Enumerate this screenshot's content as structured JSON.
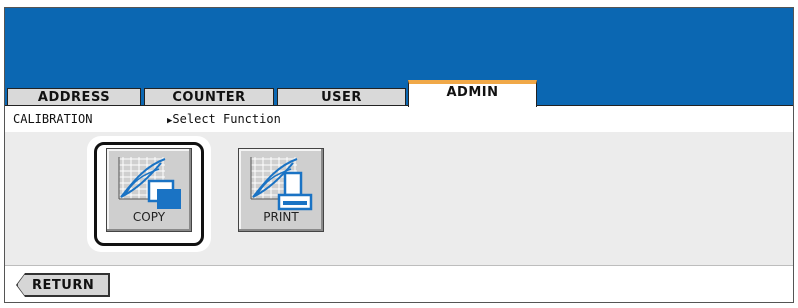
{
  "tabs": [
    {
      "label": "ADDRESS"
    },
    {
      "label": "COUNTER"
    },
    {
      "label": "USER"
    },
    {
      "label": "ADMIN",
      "active": true
    }
  ],
  "breadcrumb": {
    "section": "CALIBRATION",
    "arrow_icon": "triangle-right-icon",
    "instruction": "Select Function"
  },
  "functions": [
    {
      "label": "COPY",
      "icon": "copy-calibration-icon",
      "selected": true
    },
    {
      "label": "PRINT",
      "icon": "print-calibration-icon",
      "selected": false
    }
  ],
  "footer": {
    "return_label": "RETURN"
  },
  "colors": {
    "header": "#0b67b2",
    "active_tab_accent": "#f0a848",
    "icon_blue": "#1a73c4"
  }
}
